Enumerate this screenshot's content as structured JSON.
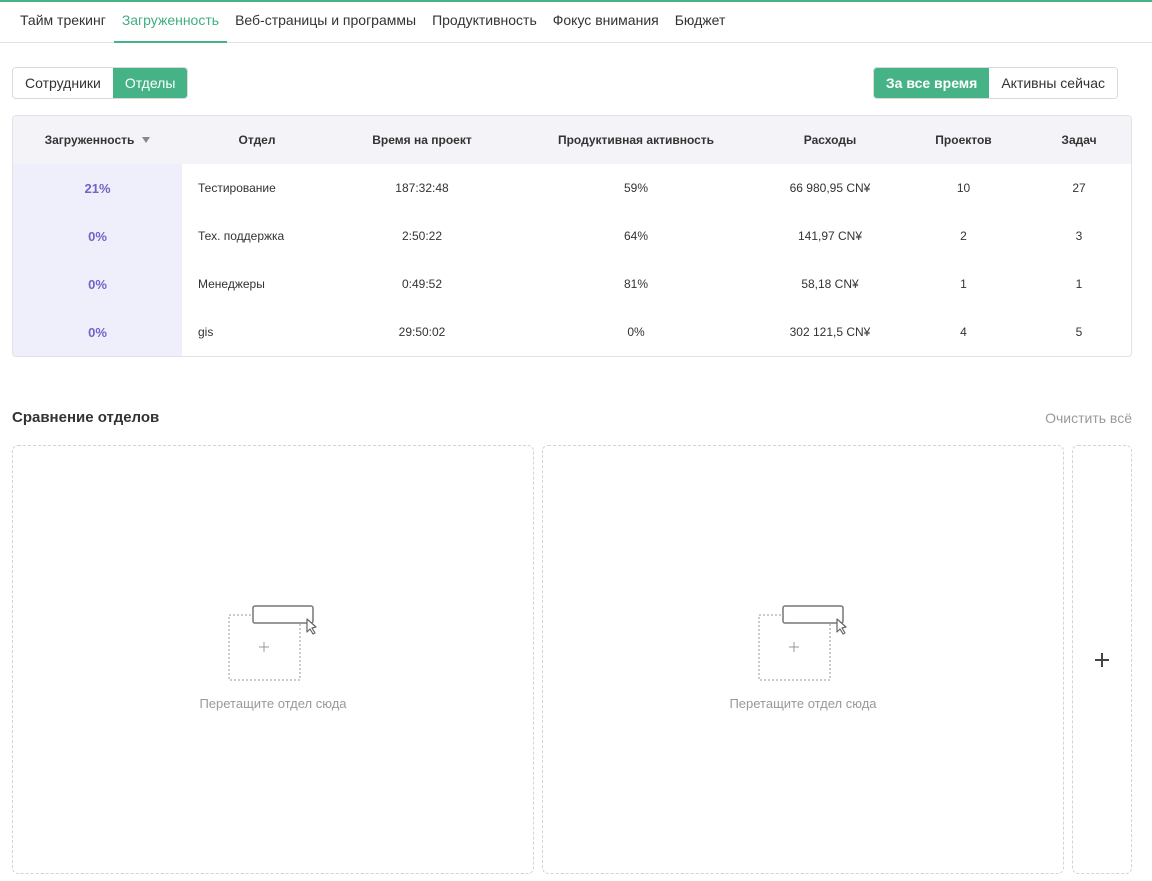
{
  "nav": {
    "tabs": [
      {
        "label": "Тайм трекинг"
      },
      {
        "label": "Загруженность"
      },
      {
        "label": "Веб-страницы и программы"
      },
      {
        "label": "Продуктивность"
      },
      {
        "label": "Фокус внимания"
      },
      {
        "label": "Бюджет"
      }
    ],
    "active": "Загруженность"
  },
  "view_toggle": {
    "employees": "Сотрудники",
    "departments": "Отделы",
    "active": "Отделы"
  },
  "time_toggle": {
    "all_time": "За все время",
    "active_now": "Активны сейчас",
    "active": "За все время"
  },
  "table": {
    "headers": [
      "Загруженность",
      "Отдел",
      "Время на проект",
      "Продуктивная активность",
      "Расходы",
      "Проектов",
      "Задач"
    ],
    "rows": [
      {
        "load": "21%",
        "dept": "Тестирование",
        "time": "187:32:48",
        "productive": "59%",
        "expenses": "66 980,95 CN¥",
        "projects": "10",
        "tasks": "27"
      },
      {
        "load": "0%",
        "dept": "Тех. поддержка",
        "time": "2:50:22",
        "productive": "64%",
        "expenses": "141,97 CN¥",
        "projects": "2",
        "tasks": "3"
      },
      {
        "load": "0%",
        "dept": "Менеджеры",
        "time": "0:49:52",
        "productive": "81%",
        "expenses": "58,18 CN¥",
        "projects": "1",
        "tasks": "1"
      },
      {
        "load": "0%",
        "dept": "gis",
        "time": "29:50:02",
        "productive": "0%",
        "expenses": "302 121,5 CN¥",
        "projects": "4",
        "tasks": "5"
      }
    ]
  },
  "comparison": {
    "title": "Сравнение отделов",
    "clear_all": "Очистить всё",
    "drop_hint": "Перетащите отдел сюда"
  },
  "colors": {
    "accent": "#45b386",
    "load_bg": "#efeffc",
    "load_text": "#7064c4"
  }
}
